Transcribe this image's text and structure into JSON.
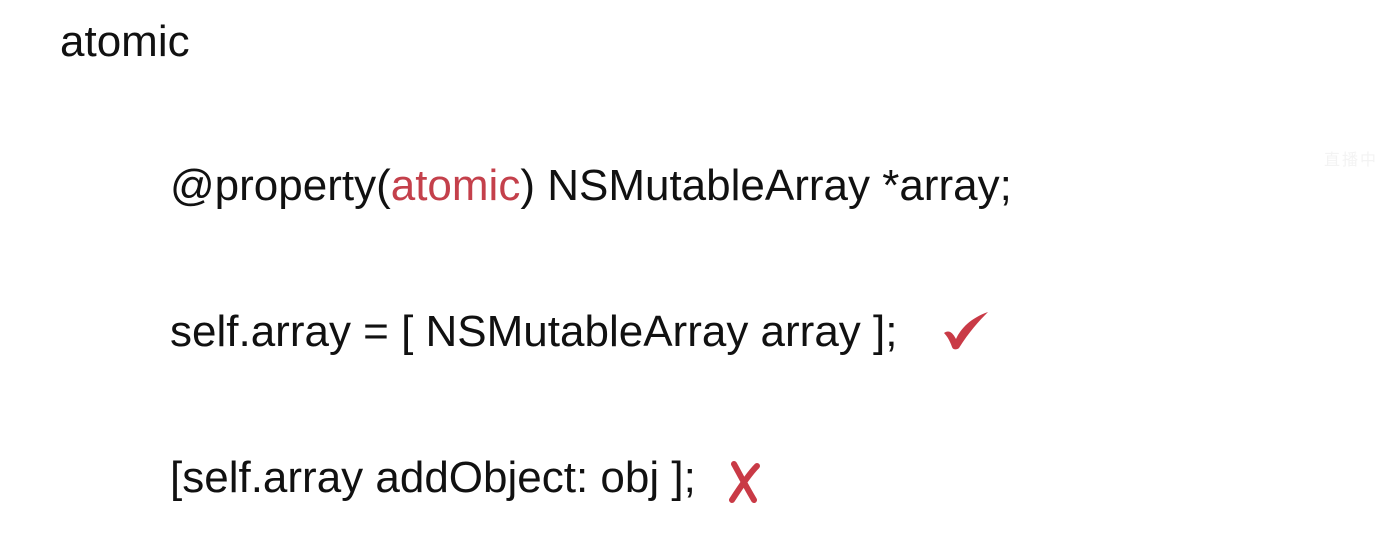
{
  "slide": {
    "title": "atomic",
    "line1": {
      "prefix": "@property(",
      "keyword": "atomic",
      "suffix": ") NSMutableArray *array;"
    },
    "line2": {
      "text": "self.array = [ NSMutableArray array ];",
      "mark": "check-icon"
    },
    "line3": {
      "text": "[self.array addObject: obj ];",
      "mark": "cross-icon"
    }
  },
  "colors": {
    "keyword": "#c4404b",
    "check": "#c93a46",
    "cross": "#c93a46",
    "text": "#111111",
    "background": "#ffffff"
  },
  "watermark": "直播中"
}
